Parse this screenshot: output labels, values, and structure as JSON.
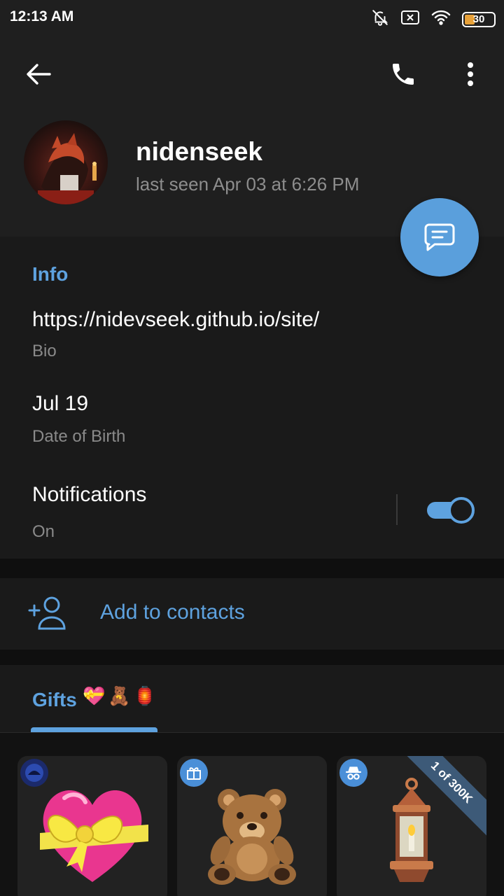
{
  "status_bar": {
    "time": "12:13 AM",
    "battery": "30",
    "icons": [
      "bell-muted-icon",
      "sim-off-icon",
      "wifi-icon",
      "battery-icon"
    ]
  },
  "header": {
    "icons": [
      "back-arrow-icon",
      "phone-icon",
      "more-vertical-icon"
    ],
    "name": "nidenseek",
    "last_seen": "last seen Apr 03 at 6:26 PM"
  },
  "info": {
    "title": "Info",
    "bio_value": "https://nidevseek.github.io/site/",
    "bio_label": "Bio",
    "dob_value": "Jul 19",
    "dob_label": "Date of Birth",
    "notifications_value": "Notifications",
    "notifications_label": "On",
    "notifications_enabled": true
  },
  "actions": {
    "add_contact": "Add to contacts"
  },
  "gifts": {
    "title": "Gifts",
    "emoji": [
      "💝",
      "🧸",
      "🏮"
    ],
    "items": [
      {
        "name": "heart-gift",
        "badge_icon": "channel-avatar-icon"
      },
      {
        "name": "teddy-bear-gift",
        "badge_icon": "gift-icon"
      },
      {
        "name": "lantern-gift",
        "badge_icon": "incognito-icon",
        "ribbon": "1 of 300K"
      }
    ]
  },
  "colors": {
    "accent": "#5ea2df",
    "fab": "#5a9fdc",
    "background": "#1a1a1a",
    "header": "#1f1f1f"
  }
}
